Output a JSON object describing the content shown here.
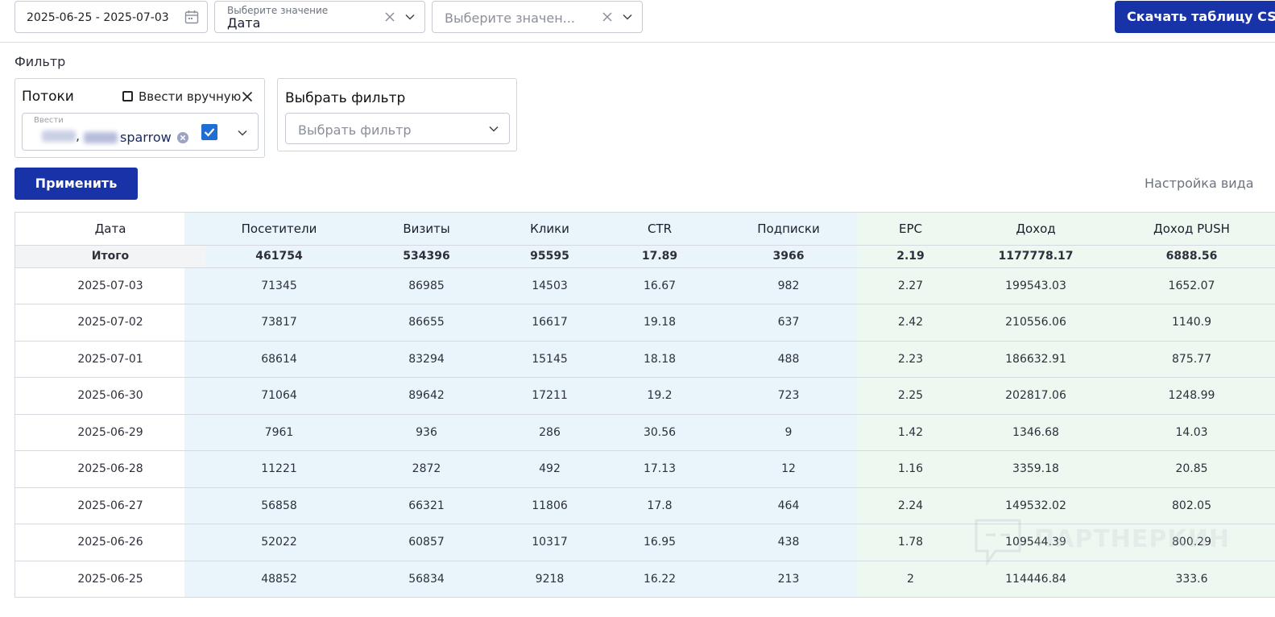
{
  "toolbar": {
    "date_range": "2025-06-25 - 2025-07-03",
    "group_label": "Выберите значение",
    "group_value": "Дата",
    "second_placeholder": "Выберите значен...",
    "csv_button": "Скачать таблицу CSV"
  },
  "filter": {
    "section_label": "Фильтр",
    "streams_title": "Потоки",
    "manual_label": "Ввести вручную",
    "input_label": "Ввести",
    "tag_text": "sparrow",
    "select_title": "Выбрать фильтр",
    "select_placeholder": "Выбрать фильтр"
  },
  "apply_button": "Применить",
  "view_settings": "Настройка вида",
  "table": {
    "headers": [
      "Дата",
      "Посетители",
      "Визиты",
      "Клики",
      "CTR",
      "Подписки",
      "EPC",
      "Доход",
      "Доход PUSH"
    ],
    "total": [
      "Итого",
      "461754",
      "534396",
      "95595",
      "17.89",
      "3966",
      "2.19",
      "1177778.17",
      "6888.56"
    ],
    "rows": [
      [
        "2025-07-03",
        "71345",
        "86985",
        "14503",
        "16.67",
        "982",
        "2.27",
        "199543.03",
        "1652.07"
      ],
      [
        "2025-07-02",
        "73817",
        "86655",
        "16617",
        "19.18",
        "637",
        "2.42",
        "210556.06",
        "1140.9"
      ],
      [
        "2025-07-01",
        "68614",
        "83294",
        "15145",
        "18.18",
        "488",
        "2.23",
        "186632.91",
        "875.77"
      ],
      [
        "2025-06-30",
        "71064",
        "89642",
        "17211",
        "19.2",
        "723",
        "2.25",
        "202817.06",
        "1248.99"
      ],
      [
        "2025-06-29",
        "7961",
        "936",
        "286",
        "30.56",
        "9",
        "1.42",
        "1346.68",
        "14.03"
      ],
      [
        "2025-06-28",
        "11221",
        "2872",
        "492",
        "17.13",
        "12",
        "1.16",
        "3359.18",
        "20.85"
      ],
      [
        "2025-06-27",
        "56858",
        "66321",
        "11806",
        "17.8",
        "464",
        "2.24",
        "149532.02",
        "802.05"
      ],
      [
        "2025-06-26",
        "52022",
        "60857",
        "10317",
        "16.95",
        "438",
        "1.78",
        "109544.39",
        "800.29"
      ],
      [
        "2025-06-25",
        "48852",
        "56834",
        "9218",
        "16.22",
        "213",
        "2",
        "114446.84",
        "333.6"
      ]
    ]
  },
  "watermark": "ПАРТНЕРКИН",
  "colors": {
    "primary": "#1733a7",
    "checkbox": "#1f6ed4",
    "blue_zone": "#e9f5fa",
    "green_zone": "#edf8f1"
  }
}
